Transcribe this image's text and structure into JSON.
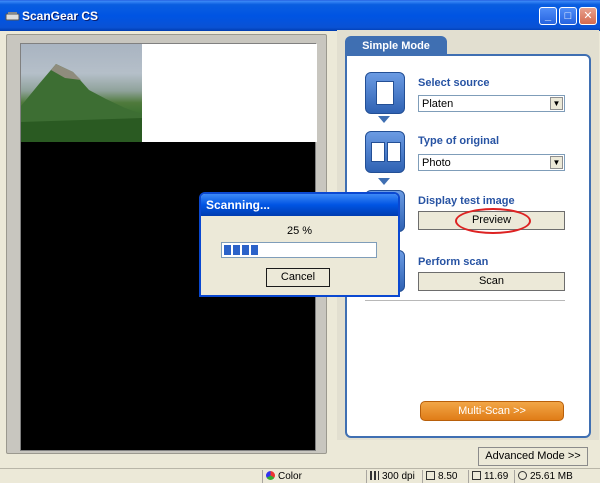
{
  "window": {
    "title": "ScanGear CS",
    "minimize_label": "_",
    "maximize_label": "□",
    "close_label": "✕"
  },
  "panel": {
    "mode_tab": "Simple Mode",
    "select_source": {
      "label": "Select source",
      "value": "Platen"
    },
    "type_of_original": {
      "label": "Type of original",
      "value": "Photo"
    },
    "display_test_image": {
      "label": "Display test image",
      "button": "Preview"
    },
    "perform_scan": {
      "label": "Perform scan",
      "button": "Scan"
    },
    "multi_scan_button": "Multi-Scan >>",
    "advanced_mode_button": "Advanced Mode >>"
  },
  "dialog": {
    "title": "Scanning...",
    "percent_text": "25 %",
    "progress": 0.25,
    "cancel_label": "Cancel"
  },
  "status": {
    "color_mode": "Color",
    "resolution": "300 dpi",
    "width": "8.50",
    "height": "11.69",
    "file_size": "25.61 MB"
  },
  "colors": {
    "accent_blue": "#3f6fb2",
    "multiscan_orange": "#e07c17",
    "highlight_red": "#dd2222"
  }
}
